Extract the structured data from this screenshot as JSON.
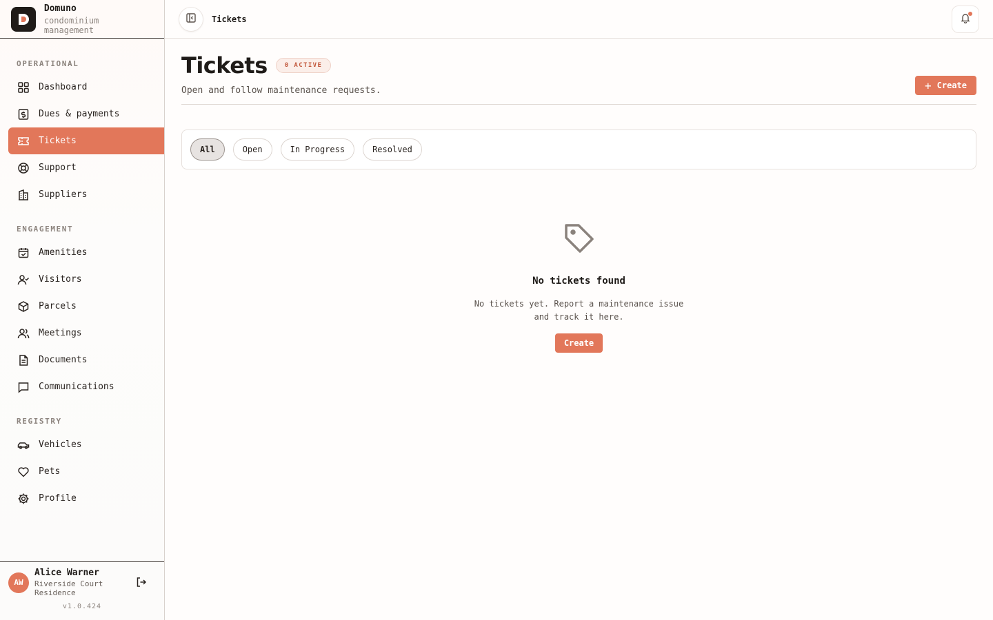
{
  "brand": {
    "name": "Domuno",
    "subtitle": "condominium management"
  },
  "nav": {
    "sections": [
      {
        "label": "OPERATIONAL"
      },
      {
        "label": "ENGAGEMENT"
      },
      {
        "label": "REGISTRY"
      }
    ],
    "items": [
      {
        "label": "Dashboard",
        "icon": "grid-icon"
      },
      {
        "label": "Dues & payments",
        "icon": "dollar-icon"
      },
      {
        "label": "Tickets",
        "icon": "ticket-icon",
        "active": true
      },
      {
        "label": "Support",
        "icon": "lifebuoy-icon"
      },
      {
        "label": "Suppliers",
        "icon": "building-icon"
      },
      {
        "label": "Amenities",
        "icon": "calendar-check-icon"
      },
      {
        "label": "Visitors",
        "icon": "user-check-icon"
      },
      {
        "label": "Parcels",
        "icon": "package-icon"
      },
      {
        "label": "Meetings",
        "icon": "users-icon"
      },
      {
        "label": "Documents",
        "icon": "file-text-icon"
      },
      {
        "label": "Communications",
        "icon": "message-icon"
      },
      {
        "label": "Vehicles",
        "icon": "car-icon"
      },
      {
        "label": "Pets",
        "icon": "heart-icon"
      },
      {
        "label": "Profile",
        "icon": "gear-icon"
      }
    ]
  },
  "user": {
    "initials": "AW",
    "name": "Alice Warner",
    "org": "Riverside Court Residence"
  },
  "version": "v1.0.424",
  "topbar": {
    "breadcrumb": "Tickets"
  },
  "page": {
    "title": "Tickets",
    "badge": "0 ACTIVE",
    "subtitle": "Open and follow maintenance requests.",
    "create_label": "Create"
  },
  "filters": [
    "All",
    "Open",
    "In Progress",
    "Resolved"
  ],
  "empty": {
    "title": "No tickets found",
    "text": "No tickets yet. Report a maintenance issue and track it here.",
    "button": "Create"
  },
  "colors": {
    "accent": "#e2775a",
    "text": "#1f1b18",
    "muted": "#8c847e"
  }
}
